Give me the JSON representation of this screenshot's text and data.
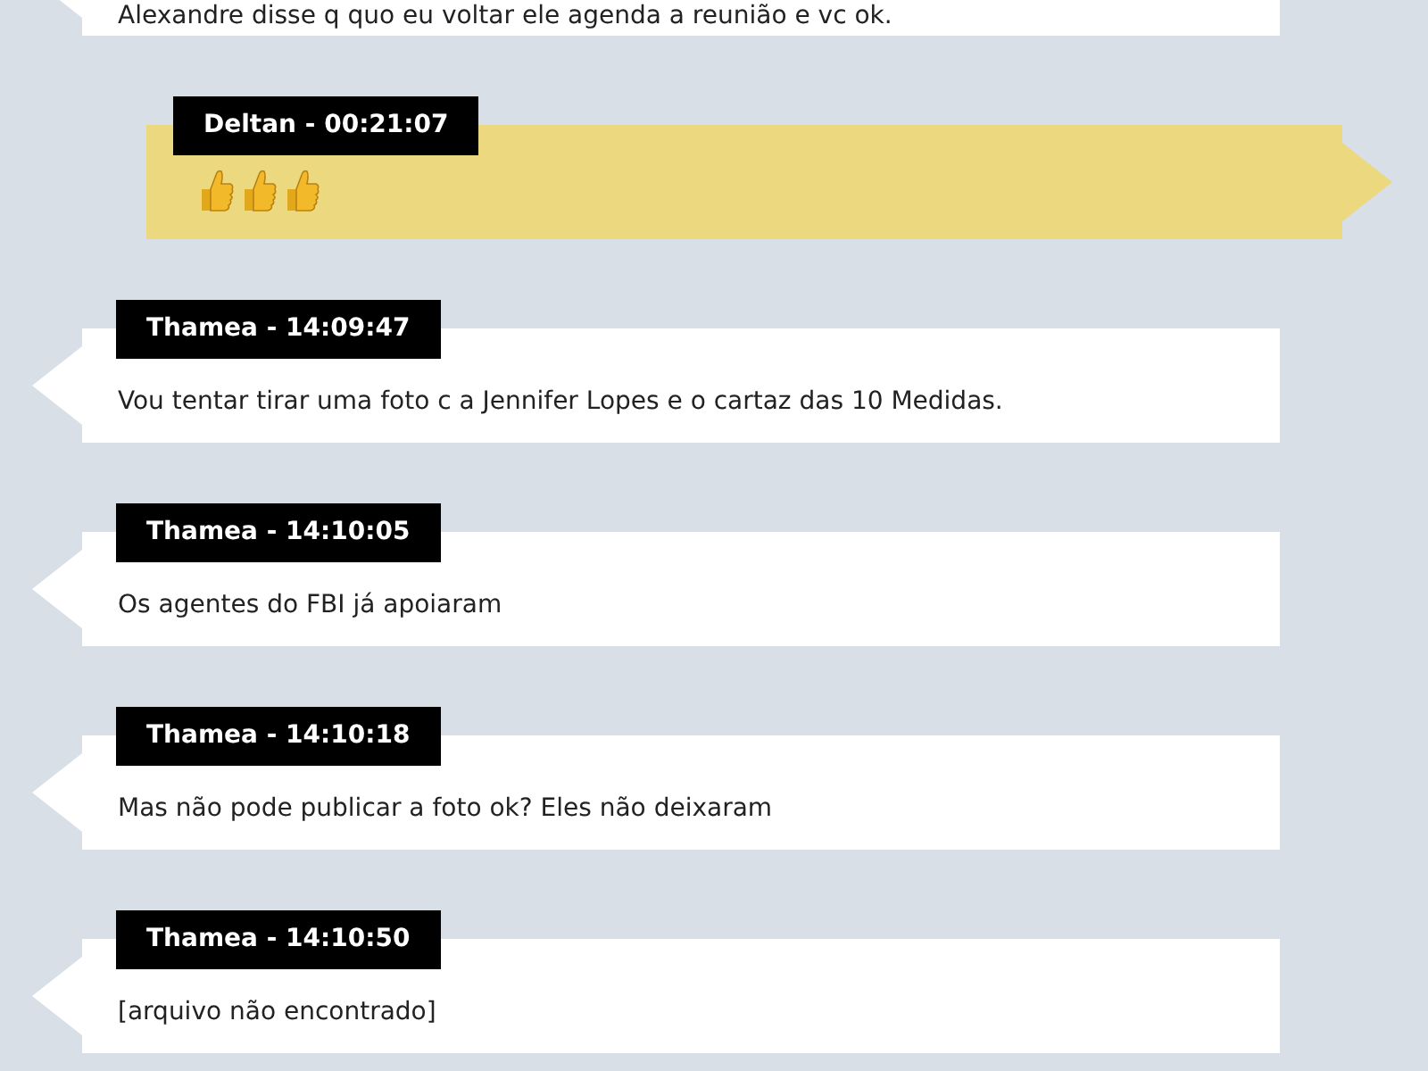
{
  "messages": [
    {
      "kind": "incoming",
      "text": "Alexandre disse q quo eu voltar ele agenda a reunião e vc ok."
    },
    {
      "kind": "outgoing",
      "author": "Deltan - 00:21:07",
      "content": [
        {
          "kind": "thumbs-up"
        },
        {
          "kind": "thumbs-up"
        },
        {
          "kind": "thumbs-up"
        }
      ]
    },
    {
      "kind": "incoming",
      "author": "Thamea - 14:09:47",
      "text": "Vou tentar tirar uma foto c a Jennifer Lopes e o cartaz das 10 Medidas."
    },
    {
      "kind": "incoming",
      "author": "Thamea - 14:10:05",
      "text": "Os agentes do FBI já apoiaram"
    },
    {
      "kind": "incoming",
      "author": "Thamea - 14:10:18",
      "text": "Mas não pode publicar a foto ok? Eles não deixaram"
    },
    {
      "kind": "incoming",
      "author": "Thamea - 14:10:50",
      "text": "[arquivo não encontrado]"
    }
  ]
}
